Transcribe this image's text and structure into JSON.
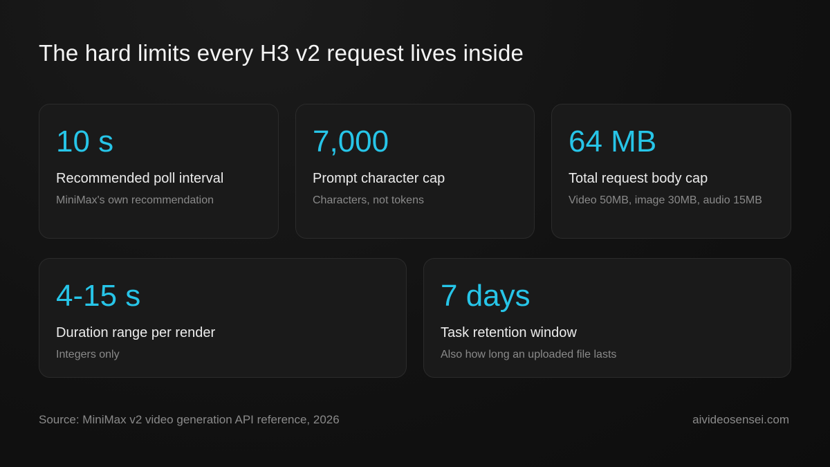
{
  "title": "The hard limits every H3 v2 request lives inside",
  "cards": [
    {
      "value": "10 s",
      "label": "Recommended poll interval",
      "note": "MiniMax's own recommendation"
    },
    {
      "value": "7,000",
      "label": "Prompt character cap",
      "note": "Characters, not tokens"
    },
    {
      "value": "64 MB",
      "label": "Total request body cap",
      "note": "Video 50MB, image 30MB, audio 15MB"
    },
    {
      "value": "4-15 s",
      "label": "Duration range per render",
      "note": "Integers only"
    },
    {
      "value": "7 days",
      "label": "Task retention window",
      "note": "Also how long an uploaded file lasts"
    }
  ],
  "footer": {
    "source": "Source: MiniMax v2 video generation API reference, 2026",
    "site": "aivideosensei.com"
  },
  "colors": {
    "accent": "#27c5e8",
    "background": "#121212",
    "card": "#1a1a1a"
  }
}
